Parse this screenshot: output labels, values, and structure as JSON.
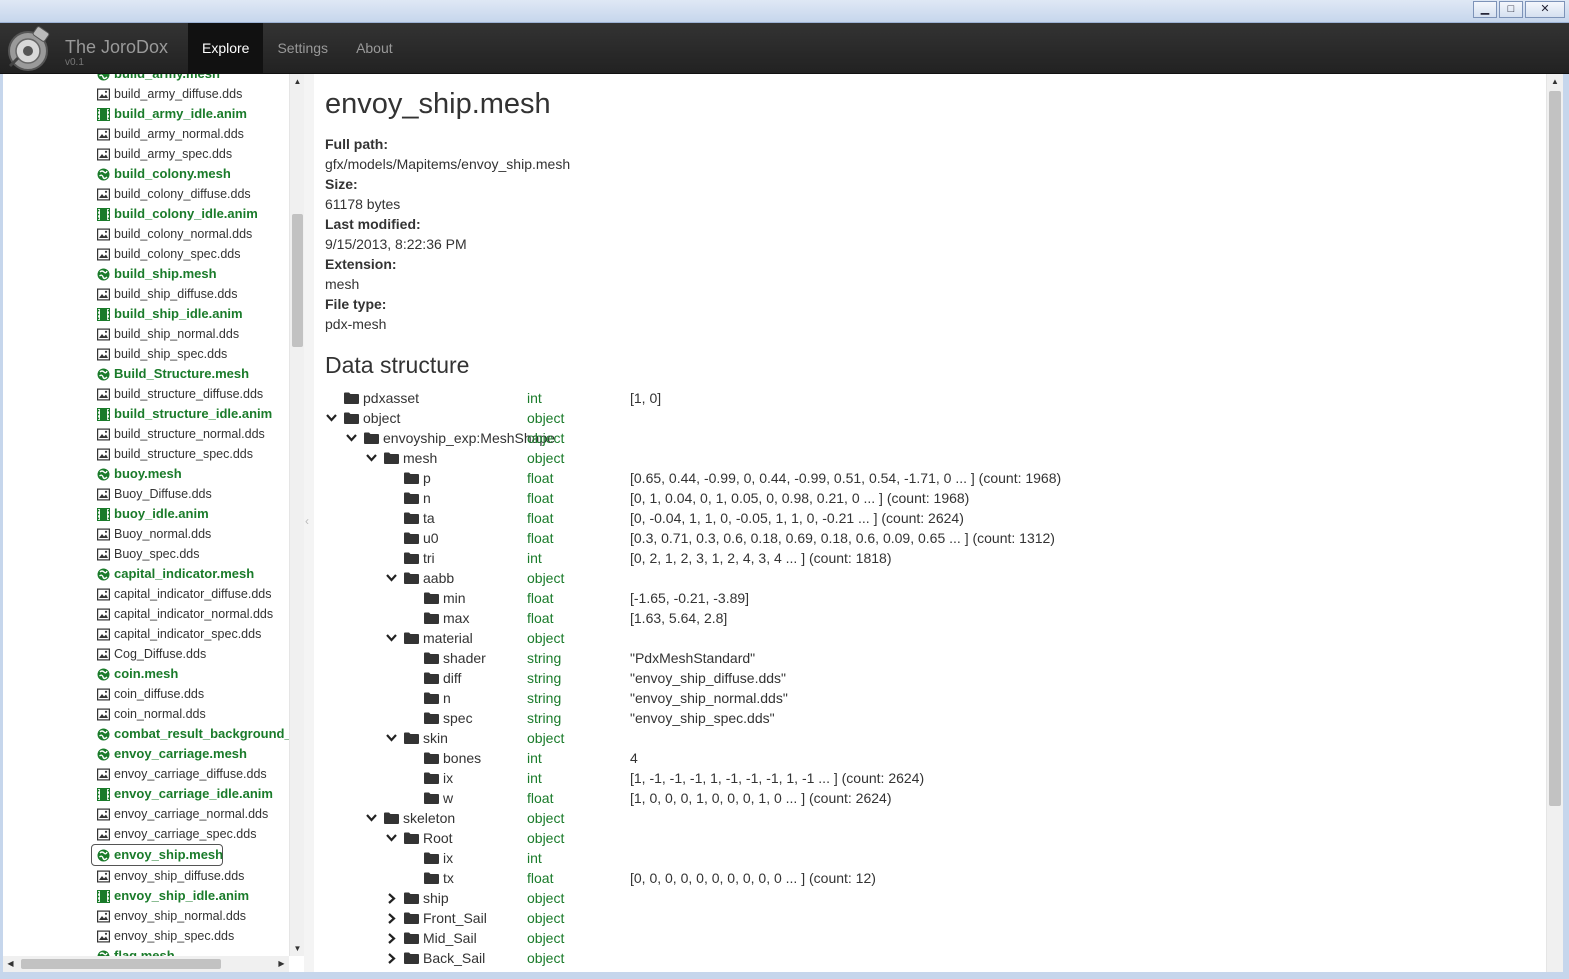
{
  "window": {
    "minimize": "▁",
    "maximize": "□",
    "close": "✕"
  },
  "app": {
    "name": "The JoroDox",
    "version": "v0.1"
  },
  "nav": [
    {
      "label": "Explore",
      "active": true
    },
    {
      "label": "Settings",
      "active": false
    },
    {
      "label": "About",
      "active": false
    }
  ],
  "files": [
    {
      "name": "build_army.mesh",
      "kind": "mesh"
    },
    {
      "name": "build_army_diffuse.dds",
      "kind": "image"
    },
    {
      "name": "build_army_idle.anim",
      "kind": "anim"
    },
    {
      "name": "build_army_normal.dds",
      "kind": "image"
    },
    {
      "name": "build_army_spec.dds",
      "kind": "image"
    },
    {
      "name": "build_colony.mesh",
      "kind": "mesh"
    },
    {
      "name": "build_colony_diffuse.dds",
      "kind": "image"
    },
    {
      "name": "build_colony_idle.anim",
      "kind": "anim"
    },
    {
      "name": "build_colony_normal.dds",
      "kind": "image"
    },
    {
      "name": "build_colony_spec.dds",
      "kind": "image"
    },
    {
      "name": "build_ship.mesh",
      "kind": "mesh"
    },
    {
      "name": "build_ship_diffuse.dds",
      "kind": "image"
    },
    {
      "name": "build_ship_idle.anim",
      "kind": "anim"
    },
    {
      "name": "build_ship_normal.dds",
      "kind": "image"
    },
    {
      "name": "build_ship_spec.dds",
      "kind": "image"
    },
    {
      "name": "Build_Structure.mesh",
      "kind": "mesh"
    },
    {
      "name": "build_structure_diffuse.dds",
      "kind": "image"
    },
    {
      "name": "build_structure_idle.anim",
      "kind": "anim"
    },
    {
      "name": "build_structure_normal.dds",
      "kind": "image"
    },
    {
      "name": "build_structure_spec.dds",
      "kind": "image"
    },
    {
      "name": "buoy.mesh",
      "kind": "mesh"
    },
    {
      "name": "Buoy_Diffuse.dds",
      "kind": "image"
    },
    {
      "name": "buoy_idle.anim",
      "kind": "anim"
    },
    {
      "name": "Buoy_normal.dds",
      "kind": "image"
    },
    {
      "name": "Buoy_spec.dds",
      "kind": "image"
    },
    {
      "name": "capital_indicator.mesh",
      "kind": "mesh"
    },
    {
      "name": "capital_indicator_diffuse.dds",
      "kind": "image"
    },
    {
      "name": "capital_indicator_normal.dds",
      "kind": "image"
    },
    {
      "name": "capital_indicator_spec.dds",
      "kind": "image"
    },
    {
      "name": "Cog_Diffuse.dds",
      "kind": "image"
    },
    {
      "name": "coin.mesh",
      "kind": "mesh"
    },
    {
      "name": "coin_diffuse.dds",
      "kind": "image"
    },
    {
      "name": "coin_normal.dds",
      "kind": "image"
    },
    {
      "name": "combat_result_background_r",
      "kind": "mesh"
    },
    {
      "name": "envoy_carriage.mesh",
      "kind": "mesh"
    },
    {
      "name": "envoy_carriage_diffuse.dds",
      "kind": "image"
    },
    {
      "name": "envoy_carriage_idle.anim",
      "kind": "anim"
    },
    {
      "name": "envoy_carriage_normal.dds",
      "kind": "image"
    },
    {
      "name": "envoy_carriage_spec.dds",
      "kind": "image"
    },
    {
      "name": "envoy_ship.mesh",
      "kind": "mesh",
      "selected": true
    },
    {
      "name": "envoy_ship_diffuse.dds",
      "kind": "image"
    },
    {
      "name": "envoy_ship_idle.anim",
      "kind": "anim"
    },
    {
      "name": "envoy_ship_normal.dds",
      "kind": "image"
    },
    {
      "name": "envoy_ship_spec.dds",
      "kind": "image"
    },
    {
      "name": "flag.mesh",
      "kind": "mesh"
    }
  ],
  "detail": {
    "title": "envoy_ship.mesh",
    "props": [
      {
        "label": "Full path:",
        "value": "gfx/models/Mapitems/envoy_ship.mesh"
      },
      {
        "label": "Size:",
        "value": "61178 bytes"
      },
      {
        "label": "Last modified:",
        "value": "9/15/2013, 8:22:36 PM"
      },
      {
        "label": "Extension:",
        "value": "mesh"
      },
      {
        "label": "File type:",
        "value": "pdx-mesh"
      }
    ],
    "structure_title": "Data structure"
  },
  "tree": [
    {
      "depth": 0,
      "toggle": "none",
      "name": "pdxasset",
      "type": "int",
      "value": "[1, 0]"
    },
    {
      "depth": 0,
      "toggle": "open",
      "name": "object",
      "type": "object",
      "value": ""
    },
    {
      "depth": 1,
      "toggle": "open",
      "name": "envoyship_exp:MeshShape",
      "type": "object",
      "value": ""
    },
    {
      "depth": 2,
      "toggle": "open",
      "name": "mesh",
      "type": "object",
      "value": ""
    },
    {
      "depth": 3,
      "toggle": "none",
      "name": "p",
      "type": "float",
      "value": "[0.65, 0.44, -0.99, 0, 0.44, -0.99, 0.51, 0.54, -1.71, 0 ... ] (count: 1968)"
    },
    {
      "depth": 3,
      "toggle": "none",
      "name": "n",
      "type": "float",
      "value": "[0, 1, 0.04, 0, 1, 0.05, 0, 0.98, 0.21, 0 ... ] (count: 1968)"
    },
    {
      "depth": 3,
      "toggle": "none",
      "name": "ta",
      "type": "float",
      "value": "[0, -0.04, 1, 1, 0, -0.05, 1, 1, 0, -0.21 ... ] (count: 2624)"
    },
    {
      "depth": 3,
      "toggle": "none",
      "name": "u0",
      "type": "float",
      "value": "[0.3, 0.71, 0.3, 0.6, 0.18, 0.69, 0.18, 0.6, 0.09, 0.65 ... ] (count: 1312)"
    },
    {
      "depth": 3,
      "toggle": "none",
      "name": "tri",
      "type": "int",
      "value": "[0, 2, 1, 2, 3, 1, 2, 4, 3, 4 ... ] (count: 1818)"
    },
    {
      "depth": 3,
      "toggle": "open",
      "name": "aabb",
      "type": "object",
      "value": ""
    },
    {
      "depth": 4,
      "toggle": "none",
      "name": "min",
      "type": "float",
      "value": "[-1.65, -0.21, -3.89]"
    },
    {
      "depth": 4,
      "toggle": "none",
      "name": "max",
      "type": "float",
      "value": "[1.63, 5.64, 2.8]"
    },
    {
      "depth": 3,
      "toggle": "open",
      "name": "material",
      "type": "object",
      "value": ""
    },
    {
      "depth": 4,
      "toggle": "none",
      "name": "shader",
      "type": "string",
      "value": "\"PdxMeshStandard\""
    },
    {
      "depth": 4,
      "toggle": "none",
      "name": "diff",
      "type": "string",
      "value": "\"envoy_ship_diffuse.dds\""
    },
    {
      "depth": 4,
      "toggle": "none",
      "name": "n",
      "type": "string",
      "value": "\"envoy_ship_normal.dds\""
    },
    {
      "depth": 4,
      "toggle": "none",
      "name": "spec",
      "type": "string",
      "value": "\"envoy_ship_spec.dds\""
    },
    {
      "depth": 3,
      "toggle": "open",
      "name": "skin",
      "type": "object",
      "value": ""
    },
    {
      "depth": 4,
      "toggle": "none",
      "name": "bones",
      "type": "int",
      "value": "4"
    },
    {
      "depth": 4,
      "toggle": "none",
      "name": "ix",
      "type": "int",
      "value": "[1, -1, -1, -1, 1, -1, -1, -1, 1, -1 ... ] (count: 2624)"
    },
    {
      "depth": 4,
      "toggle": "none",
      "name": "w",
      "type": "float",
      "value": "[1, 0, 0, 0, 1, 0, 0, 0, 1, 0 ... ] (count: 2624)"
    },
    {
      "depth": 2,
      "toggle": "open",
      "name": "skeleton",
      "type": "object",
      "value": ""
    },
    {
      "depth": 3,
      "toggle": "open",
      "name": "Root",
      "type": "object",
      "value": ""
    },
    {
      "depth": 4,
      "toggle": "none",
      "name": "ix",
      "type": "int",
      "value": ""
    },
    {
      "depth": 4,
      "toggle": "none",
      "name": "tx",
      "type": "float",
      "value": "[0, 0, 0, 0, 0, 0, 0, 0, 0, 0 ... ] (count: 12)"
    },
    {
      "depth": 3,
      "toggle": "closed",
      "name": "ship",
      "type": "object",
      "value": ""
    },
    {
      "depth": 3,
      "toggle": "closed",
      "name": "Front_Sail",
      "type": "object",
      "value": ""
    },
    {
      "depth": 3,
      "toggle": "closed",
      "name": "Mid_Sail",
      "type": "object",
      "value": ""
    },
    {
      "depth": 3,
      "toggle": "closed",
      "name": "Back_Sail",
      "type": "object",
      "value": ""
    }
  ],
  "colors": {
    "green": "#1a7b2a",
    "navbar": "#222222"
  },
  "icons": {
    "mesh": "globe-icon",
    "image": "image-icon",
    "anim": "film-icon",
    "folder": "folder-icon",
    "open": "chevron-down-icon",
    "closed": "chevron-right-icon"
  }
}
